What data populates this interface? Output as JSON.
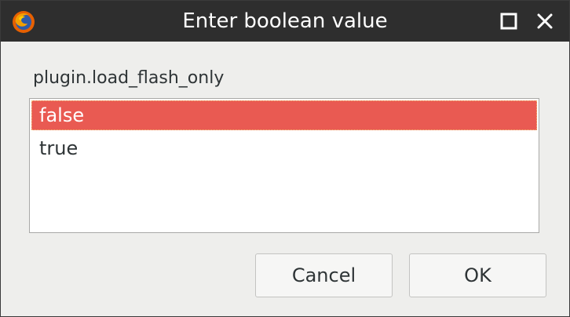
{
  "window": {
    "title": "Enter boolean value",
    "app_icon": "firefox-icon",
    "controls": {
      "maximize_icon": "maximize-icon",
      "close_icon": "close-icon"
    }
  },
  "dialog": {
    "pref_name": "plugin.load_flash_only",
    "options": [
      {
        "label": "false",
        "selected": true
      },
      {
        "label": "true",
        "selected": false
      }
    ],
    "buttons": {
      "cancel_label": "Cancel",
      "ok_label": "OK"
    }
  },
  "colors": {
    "titlebar": "#2e2e2e",
    "selection": "#e95a52",
    "background": "#eeeeec"
  }
}
